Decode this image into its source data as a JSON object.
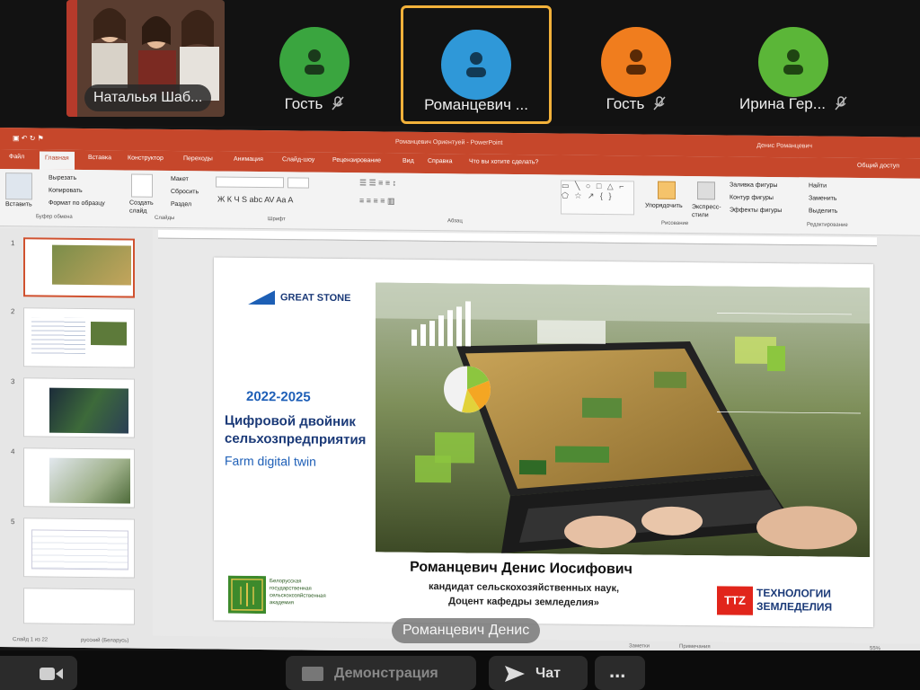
{
  "participants": {
    "video_tile": {
      "name": "Натальья Шаб..."
    },
    "tiles": [
      {
        "name": "Гость",
        "color": "#3aa53f",
        "muted": true
      },
      {
        "name": "Романцевич ...",
        "color": "#2f98d8",
        "muted": false,
        "active": true
      },
      {
        "name": "Гость",
        "color": "#f07d1e",
        "muted": true
      },
      {
        "name": "Ирина Гер...",
        "color": "#5bb638",
        "muted": true
      }
    ]
  },
  "ppt": {
    "window_title": "Романцевич Ориентуей - PowerPoint",
    "user": "Денис Романцевич",
    "tabs": [
      "Файл",
      "Главная",
      "Вставка",
      "Конструктор",
      "Переходы",
      "Анимация",
      "Слайд-шоу",
      "Рецензирование",
      "Вид",
      "Справка",
      "Что вы хотите сделать?"
    ],
    "active_tab": "Главная",
    "share_label": "Общий доступ",
    "ribbon": {
      "paste": "Вставить",
      "cut": "Вырезать",
      "copy": "Копировать",
      "format_painter": "Формат по образцу",
      "clipboard_group": "Буфер обмена",
      "new_slide": "Создать слайд",
      "layout": "Макет",
      "reset": "Сбросить",
      "section": "Раздел",
      "slides_group": "Слайды",
      "font_group": "Шрифт",
      "paragraph_group": "Абзац",
      "arrange": "Упорядочить",
      "quick_styles": "Экспресс-стили",
      "drawing_group": "Рисование",
      "shape_fill": "Заливка фигуры",
      "shape_outline": "Контур фигуры",
      "shape_effects": "Эффекты фигуры",
      "find": "Найти",
      "replace": "Заменить",
      "select": "Выделить",
      "editing_group": "Редактирование"
    },
    "slide_numbers": [
      "1",
      "2",
      "3",
      "4",
      "5"
    ],
    "slide": {
      "brand": "GREAT STONE",
      "years": "2022-2025",
      "title_ru": "Цифровой двойник сельхозпредприятия",
      "title_en": "Farm digital twin",
      "author": "Романцевич Денис Иосифович",
      "creds_line1": "кандидат сельскохозяйственных наук,",
      "creds_line2": "Доцент кафедры земледелия»",
      "bsaa_lines": [
        "Белорусская",
        "государственная",
        "сельскохозяйственная",
        "академия"
      ],
      "ttz_mark": "TTZ",
      "ttz_line1": "ТЕХНОЛОГИИ",
      "ttz_line2": "ЗЕМЛЕДЕЛИЯ"
    },
    "status": {
      "slide_count": "Слайд 1 из 22",
      "lang": "русский (Беларусь)",
      "notes": "Заметки",
      "comments": "Примечания",
      "zoom": "55%"
    }
  },
  "speaker_tag": "Романцевич Денис",
  "toolbar": {
    "demo": "Демонстрация",
    "chat": "Чат",
    "more": "..."
  }
}
